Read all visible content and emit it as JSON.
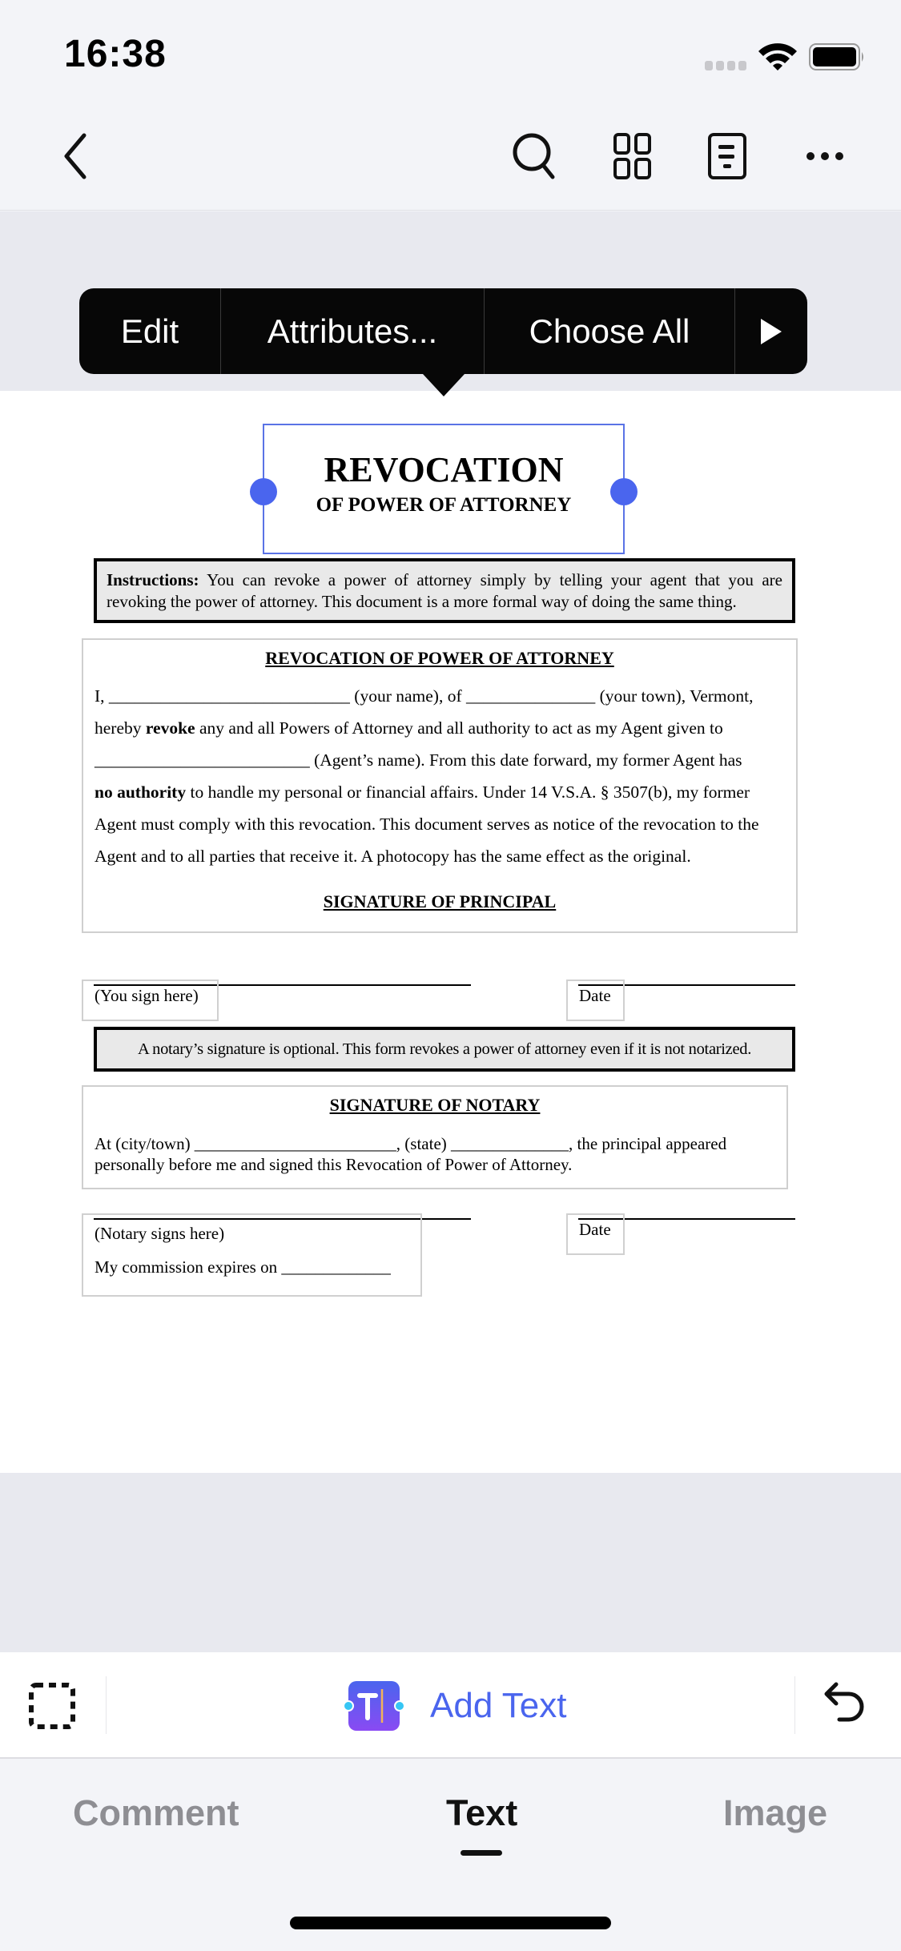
{
  "status_bar": {
    "time": "16:38"
  },
  "nav": {
    "back_icon": "chevron-left",
    "actions": [
      "search-icon",
      "grid-icon",
      "document-outline-icon",
      "more-icon"
    ]
  },
  "context_menu": {
    "items": [
      "Edit",
      "Attributes...",
      "Choose All"
    ],
    "more_icon": "play-right-icon"
  },
  "document": {
    "title_main": "REVOCATION",
    "title_sub": "OF POWER OF ATTORNEY",
    "instructions_label": "Instructions:",
    "instructions_text": " You can revoke a power of attorney simply by telling your agent that you are revoking the power of attorney.  This document is a more formal way of doing the same thing.",
    "main_heading": "REVOCATION OF POWER OF ATTORNEY",
    "body": {
      "l1": "I, ____________________________ (your name), of _______________ (your town), Vermont,",
      "l2_pre": "hereby ",
      "l2_bold": "revoke",
      "l2_post": " any and all Powers of Attorney and all authority to act as my Agent given to",
      "l3": "_________________________ (Agent’s name).  From this date forward, my former Agent has",
      "l4_bold": "no authority",
      "l4_post": " to handle my personal or financial affairs.  Under 14 V.S.A. § 3507(b), my former",
      "l5": "Agent must comply with this revocation. This document serves as notice of the revocation to the",
      "l6": "Agent and to all parties that receive it.  A photocopy has the same effect as the original."
    },
    "principal_heading": "SIGNATURE OF PRINCIPAL",
    "you_sign_here": "(You sign here)",
    "date_label": "Date",
    "notary_notice": "A notary’s signature is optional.  This form revokes a power of attorney even if it is not notarized.",
    "notary_heading": "SIGNATURE OF NOTARY",
    "notary_l1": "At (city/town)  ________________________, (state)  ______________, the principal appeared",
    "notary_l2": "personally before me and signed this Revocation of Power of Attorney.",
    "notary_signs_here": "(Notary signs here)",
    "commission": "My commission expires on _____________",
    "notary_date_label": "Date"
  },
  "toolbar": {
    "select_icon": "dashed-selection-icon",
    "add_text_label": "Add Text",
    "undo_icon": "undo-icon"
  },
  "tabs": [
    {
      "label": "Comment",
      "active": false
    },
    {
      "label": "Text",
      "active": true
    },
    {
      "label": "Image",
      "active": false
    }
  ],
  "colors": {
    "accent": "#4A65EE",
    "selection_border": "#5A73E6",
    "menu_bg": "#070707",
    "canvas_bg": "#E8E9EF",
    "chrome_bg": "#F3F4F8"
  }
}
